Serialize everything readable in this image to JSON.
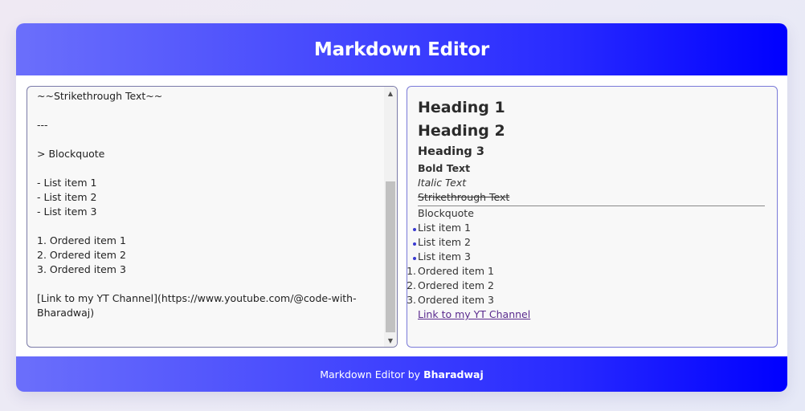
{
  "app": {
    "title": "Markdown Editor"
  },
  "editor": {
    "content": "~~Strikethrough Text~~\n\n---\n\n> Blockquote\n\n- List item 1\n- List item 2\n- List item 3\n\n1. Ordered item 1\n2. Ordered item 2\n3. Ordered item 3\n\n[Link to my YT Channel](https://www.youtube.com/@code-with-Bharadwaj)"
  },
  "preview": {
    "h1": "Heading 1",
    "h2": "Heading 2",
    "h3": "Heading 3",
    "bold": "Bold Text",
    "italic": "Italic Text",
    "strike": "Strikethrough Text",
    "blockquote": "Blockquote",
    "list": [
      "List item 1",
      "List item 2",
      "List item 3"
    ],
    "ordered_markers": [
      "1.",
      "2.",
      "3."
    ],
    "ordered": [
      "Ordered item 1",
      "Ordered item 2",
      "Ordered item 3"
    ],
    "link": "Link to my YT Channel"
  },
  "footer": {
    "prefix": "Markdown Editor by",
    "author": "Bharadwaj"
  },
  "colors": {
    "accent_start": "#6b6ffb",
    "accent_end": "#0000ff",
    "link": "#5a2a8e"
  }
}
